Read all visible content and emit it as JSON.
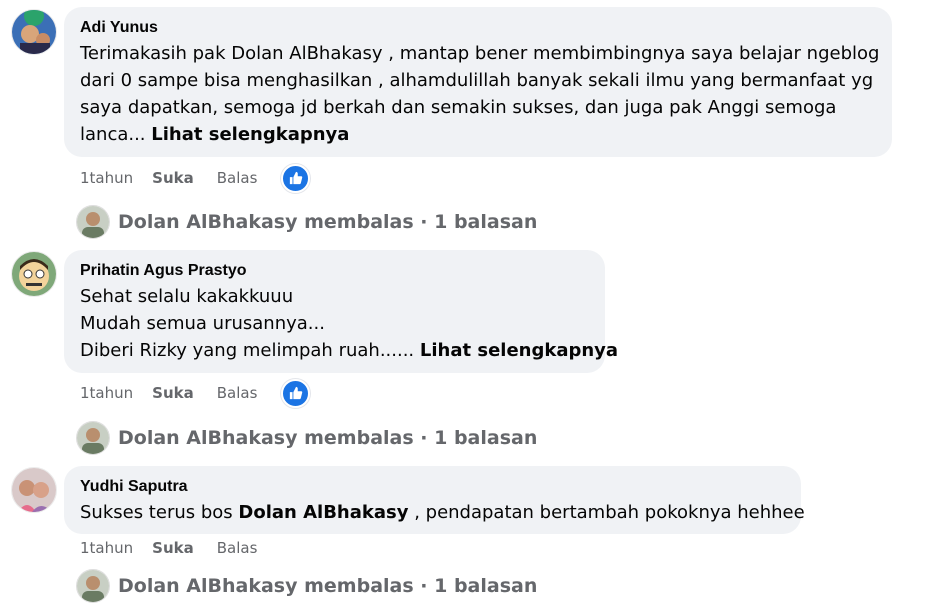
{
  "comments": [
    {
      "author": "Adi Yunus",
      "lines": [
        "Terimakasih pak Dolan AlBhakasy , mantap bener membimbingnya saya belajar ngeblog",
        "dari 0 sampe bisa menghasilkan , alhamdulillah banyak sekali ilmu yang bermanfaat yg",
        "saya dapatkan, semoga jd berkah dan semakin sukses, dan juga pak Anggi semoga"
      ],
      "last_line": "lanca...",
      "see_more": "Lihat selengkapnya",
      "time": "1tahun",
      "like_label": "Suka",
      "reply_label": "Balas",
      "reply_summary": "Dolan AlBhakasy membalas · 1 balasan",
      "avatar_icon": "user-photo-avatar"
    },
    {
      "author": "Prihatin Agus Prastyo",
      "lines": [
        "Sehat selalu kakakkuuu",
        "Mudah semua urusannya..."
      ],
      "last_line": "Diberi Rizky yang melimpah ruah......",
      "see_more": "Lihat selengkapnya",
      "time": "1tahun",
      "like_label": "Suka",
      "reply_label": "Balas",
      "reply_summary": "Dolan AlBhakasy membalas · 1 balasan",
      "avatar_icon": "cartoon-avatar"
    },
    {
      "author": "Yudhi Saputra",
      "text_before": "Sukses terus bos",
      "mention": "Dolan AlBhakasy",
      "text_after": ", pendapatan bertambah pokoknya hehhee",
      "time": "1tahun",
      "like_label": "Suka",
      "reply_label": "Balas",
      "reply_summary": "Dolan AlBhakasy membalas · 1 balasan",
      "avatar_icon": "user-photo-avatar"
    }
  ],
  "colors": {
    "bubble": "#f0f2f5",
    "secondary_text": "#65676b",
    "like_blue": "#1b74e4"
  }
}
